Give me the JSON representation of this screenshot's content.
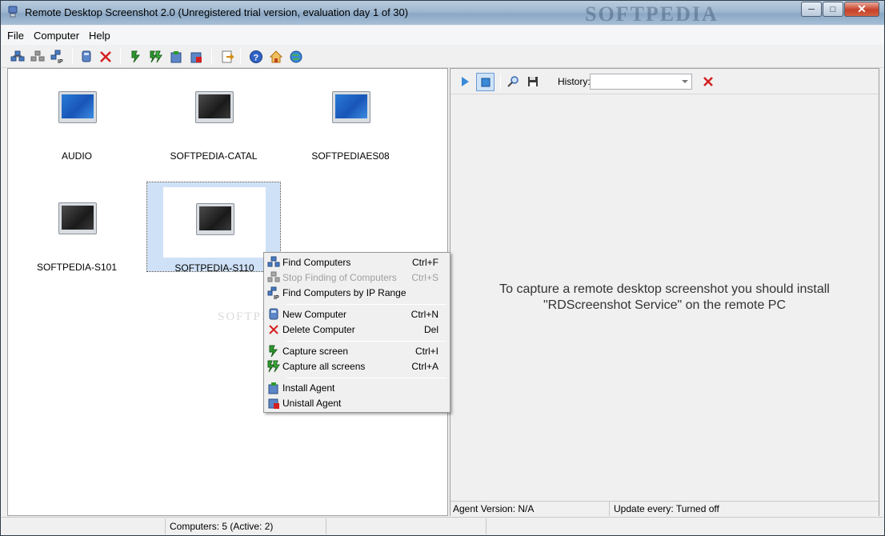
{
  "window": {
    "title": "Remote Desktop Screenshot 2.0 (Unregistered trial version, evaluation day 1 of 30)",
    "watermark": "SOFTPEDIA"
  },
  "menubar": {
    "items": [
      "File",
      "Computer",
      "Help"
    ]
  },
  "toolbar": {
    "buttons": [
      "find-computers-icon",
      "stop-finding-icon",
      "find-by-ip-icon",
      "new-computer-icon",
      "delete-computer-icon",
      "capture-screen-icon",
      "capture-all-screens-icon",
      "install-agent-icon",
      "uninstall-agent-icon",
      "export-icon",
      "help-icon",
      "home-icon",
      "web-icon"
    ]
  },
  "computers": [
    {
      "name": "AUDIO",
      "state": "active",
      "selected": false
    },
    {
      "name": "SOFTPEDIA-CATAL",
      "state": "inactive",
      "selected": false
    },
    {
      "name": "SOFTPEDIAES08",
      "state": "active",
      "selected": false
    },
    {
      "name": "SOFTPEDIA-S101",
      "state": "inactive",
      "selected": false
    },
    {
      "name": "SOFTPEDIA-S110",
      "state": "inactive",
      "selected": true
    }
  ],
  "context_menu": {
    "items": [
      {
        "label": "Find Computers",
        "shortcut": "Ctrl+F",
        "icon": "find-computers-icon",
        "enabled": true
      },
      {
        "label": "Stop Finding of Computers",
        "shortcut": "Ctrl+S",
        "icon": "stop-finding-icon",
        "enabled": false
      },
      {
        "label": "Find Computers by IP Range",
        "shortcut": "",
        "icon": "find-by-ip-icon",
        "enabled": true
      },
      {
        "label": "New Computer",
        "shortcut": "Ctrl+N",
        "icon": "new-computer-icon",
        "enabled": true
      },
      {
        "label": "Delete Computer",
        "shortcut": "Del",
        "icon": "delete-icon",
        "enabled": true
      },
      {
        "label": "Capture screen",
        "shortcut": "Ctrl+I",
        "icon": "capture-screen-icon",
        "enabled": true
      },
      {
        "label": "Capture all screens",
        "shortcut": "Ctrl+A",
        "icon": "capture-all-icon",
        "enabled": true
      },
      {
        "label": "Install Agent",
        "shortcut": "",
        "icon": "install-agent-icon",
        "enabled": true
      },
      {
        "label": "Unistall Agent",
        "shortcut": "",
        "icon": "uninstall-agent-icon",
        "enabled": true
      }
    ]
  },
  "right_pane": {
    "history_label": "History:",
    "history_value": "",
    "message_line1": "To capture a remote desktop screenshot you should install",
    "message_line2": "\"RDScreenshot Service\" on the remote PC",
    "agent_version": "Agent Version: N/A",
    "update_every": "Update every: Turned off"
  },
  "statusbar": {
    "computers": "Computers: 5 (Active: 2)"
  },
  "colors": {
    "accent": "#1f6fd0",
    "delete_red": "#d42020",
    "capture_green": "#2e9a2e"
  }
}
